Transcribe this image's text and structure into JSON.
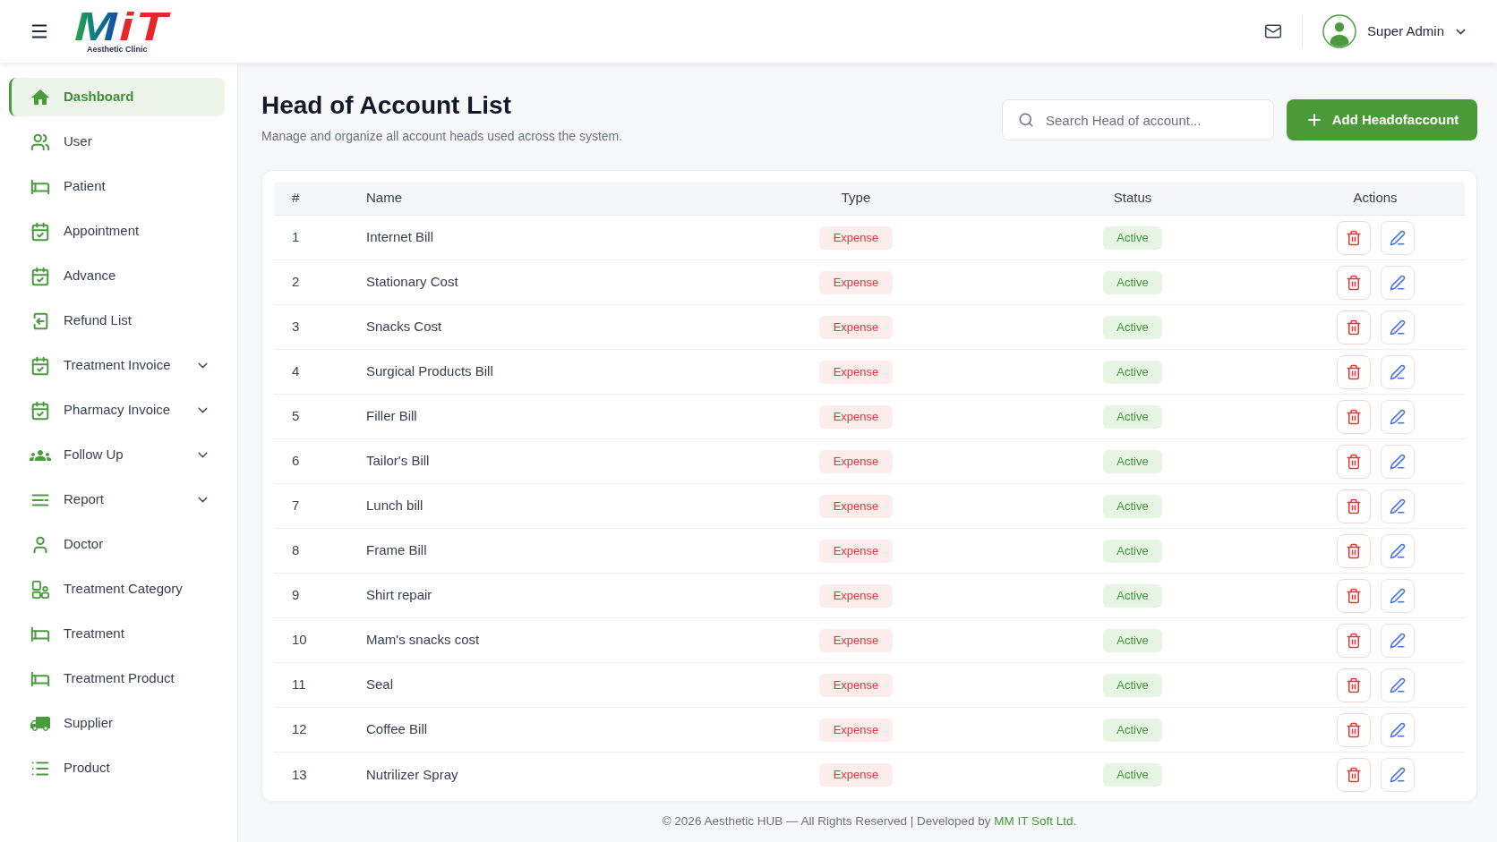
{
  "header": {
    "logo": {
      "wordmark": "MiT",
      "tagline": "Aesthetic Clinic"
    },
    "user": {
      "name": "Super Admin"
    }
  },
  "sidebar": {
    "items": [
      {
        "label": "Dashboard",
        "selected": true,
        "submenu": false
      },
      {
        "label": "User",
        "selected": false,
        "submenu": false
      },
      {
        "label": "Patient",
        "selected": false,
        "submenu": false
      },
      {
        "label": "Appointment",
        "selected": false,
        "submenu": false
      },
      {
        "label": "Advance",
        "selected": false,
        "submenu": false
      },
      {
        "label": "Refund List",
        "selected": false,
        "submenu": false
      },
      {
        "label": "Treatment Invoice",
        "selected": false,
        "submenu": true
      },
      {
        "label": "Pharmacy Invoice",
        "selected": false,
        "submenu": true
      },
      {
        "label": "Follow Up",
        "selected": false,
        "submenu": true
      },
      {
        "label": "Report",
        "selected": false,
        "submenu": true
      },
      {
        "label": "Doctor",
        "selected": false,
        "submenu": false
      },
      {
        "label": "Treatment Category",
        "selected": false,
        "submenu": false
      },
      {
        "label": "Treatment",
        "selected": false,
        "submenu": false
      },
      {
        "label": "Treatment Product",
        "selected": false,
        "submenu": false
      },
      {
        "label": "Supplier",
        "selected": false,
        "submenu": false
      },
      {
        "label": "Product",
        "selected": false,
        "submenu": false
      }
    ]
  },
  "page": {
    "title": "Head of Account List",
    "subtitle": "Manage and organize all account heads used across the system.",
    "search": {
      "placeholder": "Search Head of account..."
    },
    "add_button": "Add Headofaccount"
  },
  "table": {
    "columns": [
      "#",
      "Name",
      "Type",
      "Status",
      "Actions"
    ],
    "rows": [
      {
        "number": "1",
        "name": "Internet Bill",
        "type": "Expense",
        "status": "Active"
      },
      {
        "number": "2",
        "name": "Stationary Cost",
        "type": "Expense",
        "status": "Active"
      },
      {
        "number": "3",
        "name": "Snacks Cost",
        "type": "Expense",
        "status": "Active"
      },
      {
        "number": "4",
        "name": "Surgical Products Bill",
        "type": "Expense",
        "status": "Active"
      },
      {
        "number": "5",
        "name": "Filler Bill",
        "type": "Expense",
        "status": "Active"
      },
      {
        "number": "6",
        "name": "Tailor's Bill",
        "type": "Expense",
        "status": "Active"
      },
      {
        "number": "7",
        "name": "Lunch bill",
        "type": "Expense",
        "status": "Active"
      },
      {
        "number": "8",
        "name": "Frame Bill",
        "type": "Expense",
        "status": "Active"
      },
      {
        "number": "9",
        "name": "Shirt repair",
        "type": "Expense",
        "status": "Active"
      },
      {
        "number": "10",
        "name": "Mam's snacks cost",
        "type": "Expense",
        "status": "Active"
      },
      {
        "number": "11",
        "name": "Seal",
        "type": "Expense",
        "status": "Active"
      },
      {
        "number": "12",
        "name": "Coffee Bill",
        "type": "Expense",
        "status": "Active"
      },
      {
        "number": "13",
        "name": "Nutrilizer Spray",
        "type": "Expense",
        "status": "Active"
      }
    ]
  },
  "footer": {
    "text": "© 2026 Aesthetic HUB — All Rights Reserved | Developed by",
    "link": "MM IT Soft Ltd."
  }
}
